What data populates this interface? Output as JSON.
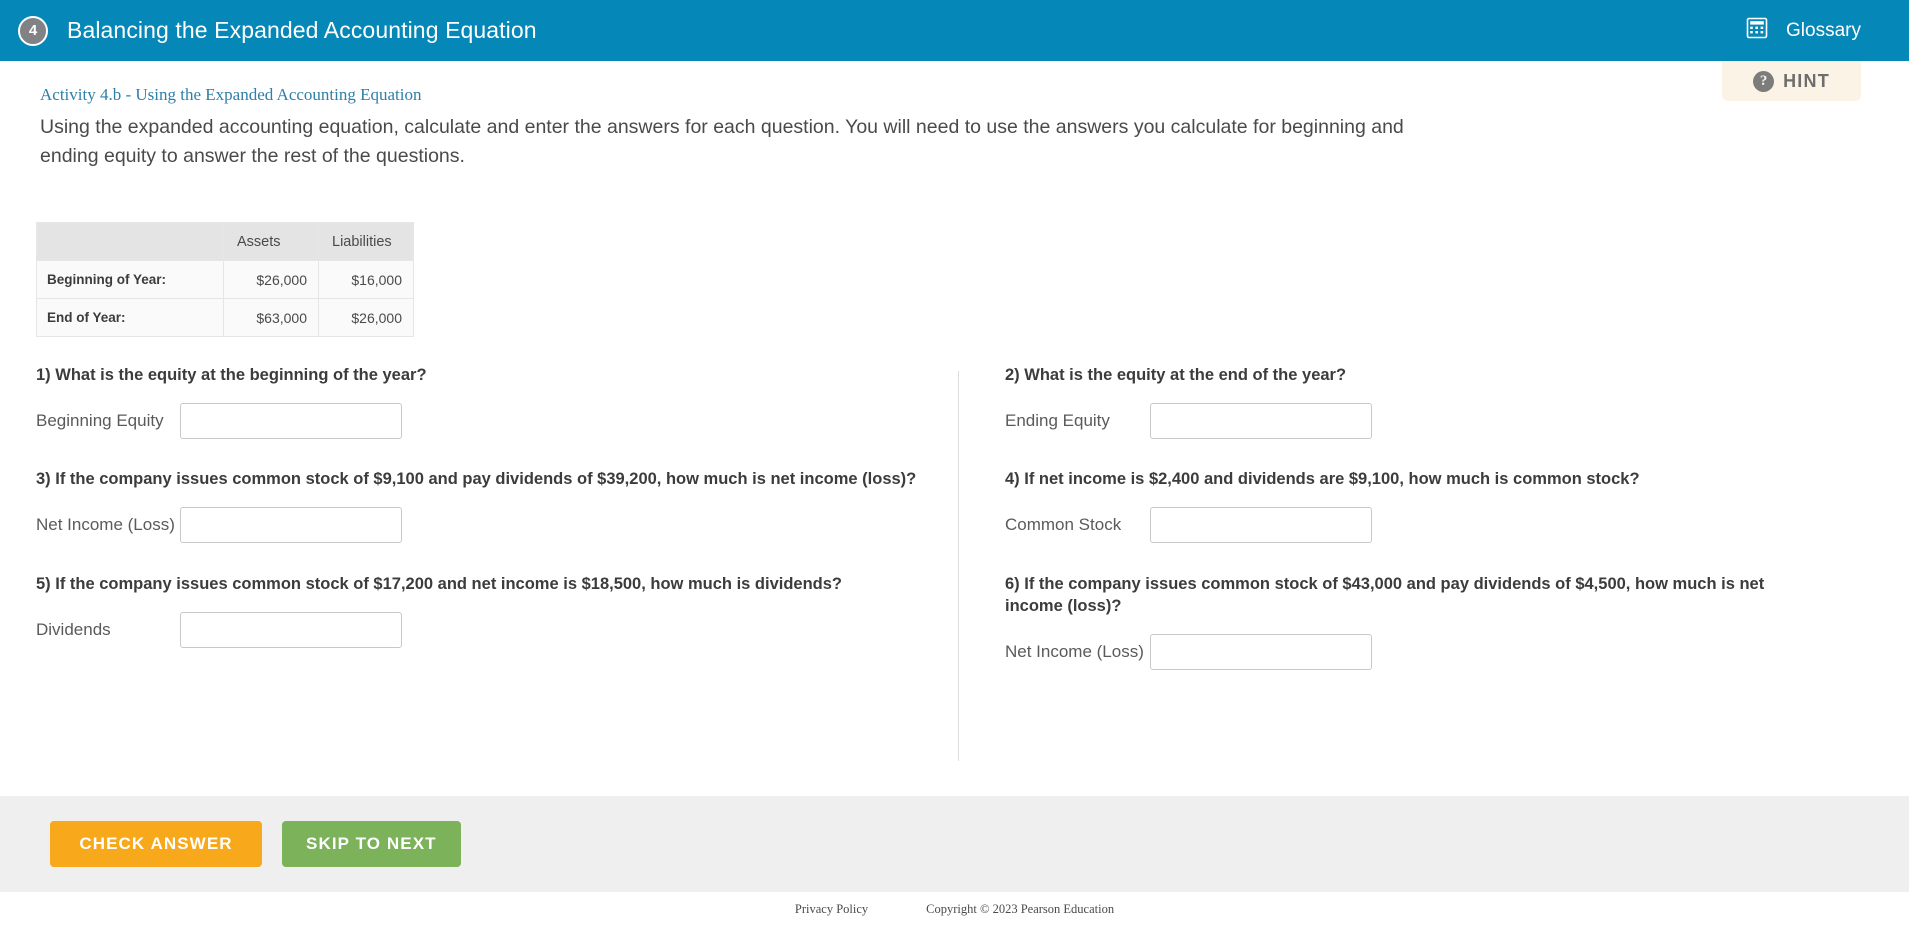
{
  "header": {
    "lesson_number": "4",
    "title": "Balancing the Expanded Accounting Equation",
    "glossary_label": "Glossary",
    "calculator_icon": "calculator-icon",
    "brand_color": "#0587B8"
  },
  "hint": {
    "label": "HINT",
    "icon": "question-circle-icon",
    "background_color": "#FAF3E6"
  },
  "activity": {
    "link_text": "Activity 4.b - Using the Expanded Accounting Equation",
    "link_color": "#2F7FA8",
    "instructions": "Using the expanded accounting equation, calculate and enter the answers for each question. You will need to use the answers you calculate for beginning and ending equity to answer the rest of the questions."
  },
  "table": {
    "headers": [
      "",
      "Assets",
      "Liabilities"
    ],
    "rows": [
      {
        "label": "Beginning of Year:",
        "assets": "$26,000",
        "liabilities": "$16,000"
      },
      {
        "label": "End of Year:",
        "assets": "$63,000",
        "liabilities": "$26,000"
      }
    ]
  },
  "questions": [
    {
      "id": "q1",
      "text": "1) What is the equity at the beginning of the year?",
      "answer_label": "Beginning Equity",
      "answer_value": "",
      "placeholder": ""
    },
    {
      "id": "q2",
      "text": "2) What is the equity at the end of the year?",
      "answer_label": "Ending Equity",
      "answer_value": "",
      "placeholder": ""
    },
    {
      "id": "q3",
      "text": "3) If the company issues common stock of $9,100 and pay dividends of $39,200, how much is net income (loss)?",
      "answer_label": "Net Income (Loss)",
      "answer_value": "",
      "placeholder": ""
    },
    {
      "id": "q4",
      "text": "4) If net income is $2,400 and dividends are $9,100, how much is common stock?",
      "answer_label": "Common Stock",
      "answer_value": "",
      "placeholder": ""
    },
    {
      "id": "q5",
      "text": "5) If the company issues common stock of $17,200 and net income is $18,500, how much is dividends?",
      "answer_label": "Dividends",
      "answer_value": "",
      "placeholder": ""
    },
    {
      "id": "q6",
      "text": "6) If the company issues common stock of $43,000 and pay dividends of $4,500, how much is net income (loss)?",
      "answer_label": "Net Income (Loss)",
      "answer_value": "",
      "placeholder": ""
    }
  ],
  "actions": {
    "check_answer_label": "CHECK ANSWER",
    "check_answer_color": "#F7A81B",
    "skip_to_next_label": "SKIP TO NEXT",
    "skip_to_next_color": "#7CB25A"
  },
  "footer": {
    "privacy_policy": "Privacy Policy",
    "copyright": "Copyright © 2023 Pearson Education"
  }
}
